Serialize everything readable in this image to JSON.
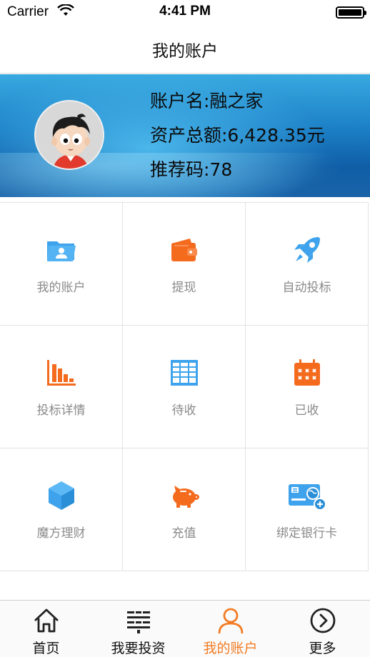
{
  "status_bar": {
    "carrier": "Carrier",
    "time": "4:41 PM",
    "wifi_icon": "wifi-icon",
    "battery_icon": "battery-icon"
  },
  "nav": {
    "title": "我的账户"
  },
  "profile": {
    "account_name": "账户名:融之家",
    "total_assets": "资产总额:6,428.35元",
    "referral_code": "推荐码:78",
    "avatar_icon": "avatar-cartoon-boy"
  },
  "menu": {
    "items": [
      {
        "label": "我的账户",
        "icon": "folder-user-icon",
        "color": "#3ea3ec"
      },
      {
        "label": "提现",
        "icon": "wallet-icon",
        "color": "#f46b1e"
      },
      {
        "label": "自动投标",
        "icon": "rocket-icon",
        "color": "#3ea3ec"
      },
      {
        "label": "投标详情",
        "icon": "bar-chart-icon",
        "color": "#f46b1e"
      },
      {
        "label": "待收",
        "icon": "table-icon",
        "color": "#3ea3ec"
      },
      {
        "label": "已收",
        "icon": "calendar-icon",
        "color": "#f46b1e"
      },
      {
        "label": "魔方理财",
        "icon": "cube-icon",
        "color": "#3ea3ec"
      },
      {
        "label": "充值",
        "icon": "piggy-bank-icon",
        "color": "#f46b1e"
      },
      {
        "label": "绑定银行卡",
        "icon": "bank-card-icon",
        "color": "#3ea3ec"
      }
    ]
  },
  "tabbar": {
    "items": [
      {
        "label": "首页",
        "icon": "home-icon"
      },
      {
        "label": "我要投资",
        "icon": "list-icon"
      },
      {
        "label": "我的账户",
        "icon": "user-icon",
        "active": true
      },
      {
        "label": "更多",
        "icon": "chevron-circle-icon"
      }
    ],
    "active_color": "#f27c25"
  }
}
